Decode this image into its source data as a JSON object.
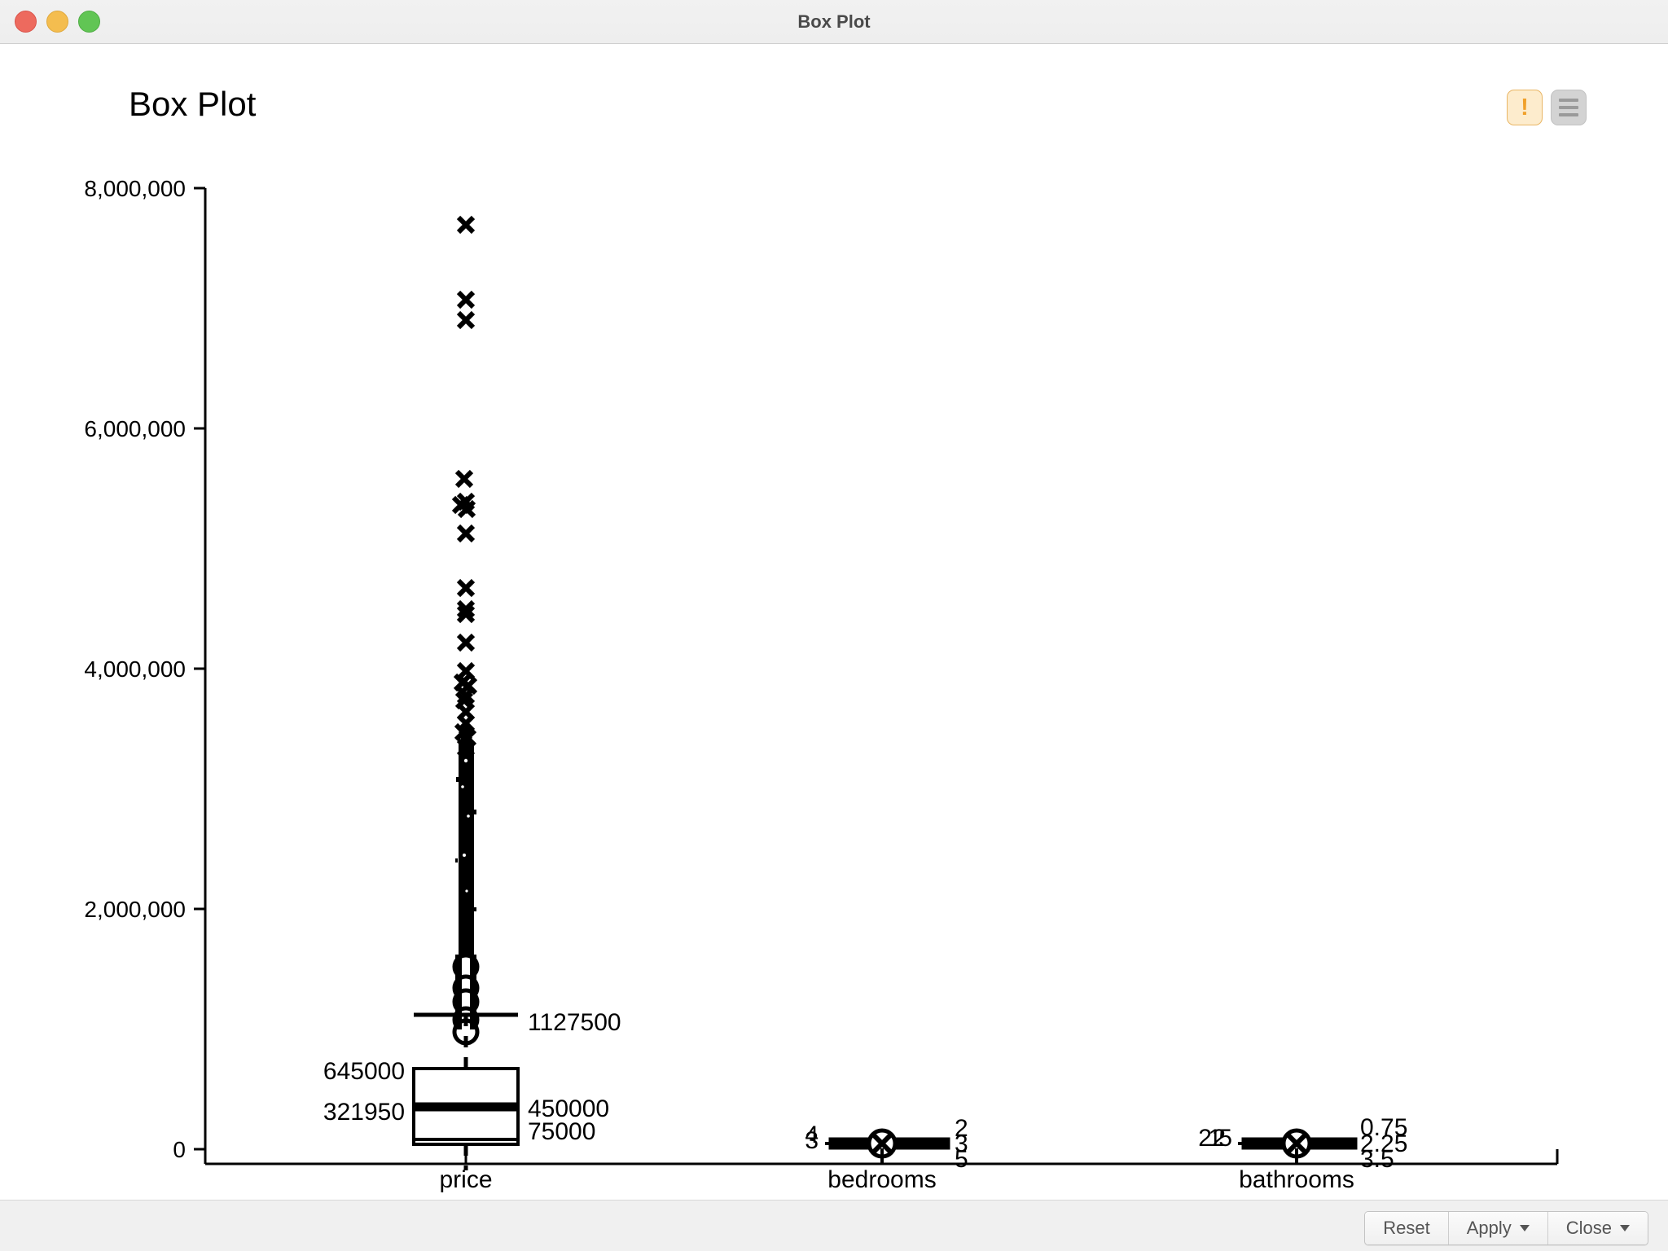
{
  "window": {
    "title": "Box Plot",
    "traffic_lights": [
      {
        "name": "close",
        "color": "#ed6a5e"
      },
      {
        "name": "minimize",
        "color": "#f4bd4f"
      },
      {
        "name": "maximize",
        "color": "#61c554"
      }
    ]
  },
  "toolbar": {
    "warning_icon": "warning-icon",
    "warning_glyph": "!",
    "menu_icon": "hamburger-menu-icon"
  },
  "footer": {
    "reset_label": "Reset",
    "apply_label": "Apply",
    "close_label": "Close"
  },
  "chart_data": {
    "type": "box",
    "title": "Box Plot",
    "xlabel": "",
    "ylabel": "",
    "ylim": [
      0,
      8000000
    ],
    "grid": false,
    "legend": false,
    "ytick_labels": [
      "8,000,000",
      "6,000,000",
      "4,000,000",
      "2,000,000",
      "0"
    ],
    "ytick_values": [
      8000000,
      6000000,
      4000000,
      2000000,
      0
    ],
    "categories": [
      "price",
      "bedrooms",
      "bathrooms"
    ],
    "series": [
      {
        "name": "price",
        "lower_whisker": 75000,
        "q1": 321950,
        "median": 450000,
        "q3": 645000,
        "upper_whisker": 1127500,
        "labels": {
          "upper_whisker": "1127500",
          "q3": "645000",
          "median": "450000",
          "q1": "321950",
          "lower_whisker": "75000"
        },
        "outliers_note": "many outliers above upper whisker up to ~7,700,000",
        "outlier_top_values": [
          7700000,
          7000000,
          6900000,
          5570000,
          5350000,
          5300000,
          5110000,
          4670000,
          4500000,
          4450000,
          4210000,
          3990000,
          3900000,
          3850000,
          3800000
        ]
      },
      {
        "name": "bedrooms",
        "lower_whisker": 1,
        "q1": 3,
        "median": 3,
        "q3": 4,
        "upper_whisker": 5,
        "labels_left": [
          "3",
          "4"
        ],
        "labels_right": [
          "2",
          "3",
          "5"
        ]
      },
      {
        "name": "bathrooms",
        "lower_whisker": 0.75,
        "q1": 1.75,
        "median": 2.25,
        "q3": 2.5,
        "upper_whisker": 3.5,
        "labels_left": [
          "1",
          "2",
          "2.5"
        ],
        "labels_right": [
          "0.75",
          "2.25",
          "3.5"
        ]
      }
    ]
  }
}
